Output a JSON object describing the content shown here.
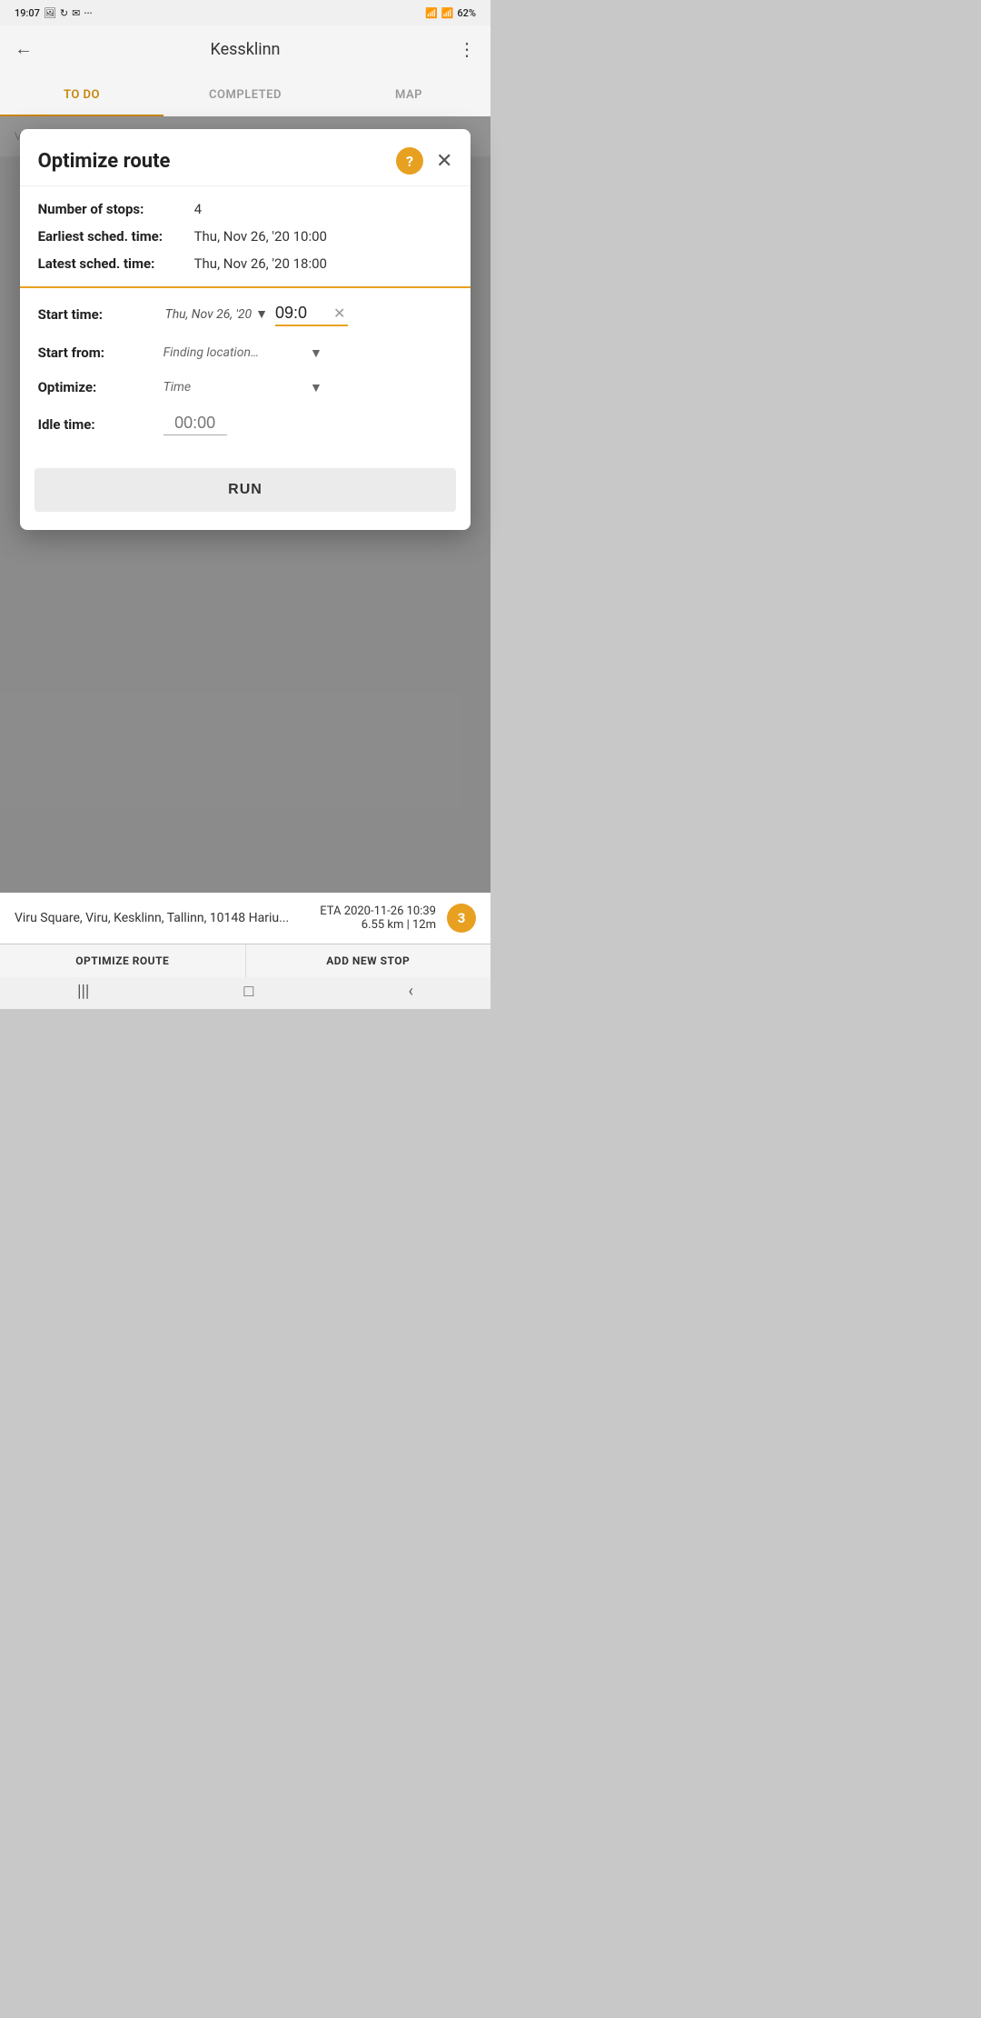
{
  "statusBar": {
    "time": "19:07",
    "icons": [
      "photo",
      "phone-rotate",
      "email",
      "more"
    ],
    "rightIcons": [
      "wifi",
      "signal",
      "signal2",
      "battery"
    ],
    "battery": "62%"
  },
  "appBar": {
    "title": "Kessklinn",
    "backLabel": "←",
    "moreLabel": "⋮"
  },
  "tabs": [
    {
      "id": "todo",
      "label": "TO DO",
      "active": true
    },
    {
      "id": "completed",
      "label": "COMPLETED",
      "active": false
    },
    {
      "id": "map",
      "label": "MAP",
      "active": false
    }
  ],
  "dialog": {
    "title": "Optimize route",
    "helpLabel": "?",
    "closeLabel": "✕",
    "info": {
      "stopsLabel": "Number of stops:",
      "stopsValue": "4",
      "earliestLabel": "Earliest sched. time:",
      "earliestValue": "Thu, Nov 26, '20 10:00",
      "latestLabel": "Latest sched. time:",
      "latestValue": "Thu, Nov 26, '20 18:00"
    },
    "form": {
      "startTimeLabel": "Start time:",
      "startDateValue": "Thu, Nov 26, '20",
      "startTimeValue": "09:0",
      "startFromLabel": "Start from:",
      "startFromValue": "Finding location…",
      "optimizeLabel": "Optimize:",
      "optimizeValue": "Time",
      "idleTimeLabel": "Idle time:",
      "idleTimeValue": "00:00",
      "idleTimePlaceholder": "00:00"
    },
    "runButton": "RUN"
  },
  "bottomCard": {
    "title": "Viru Square, Viru, Kesklinn, Tallinn, 10148 Hariu...",
    "eta": "ETA 2020-11-26 10:39",
    "distance": "6.55 km | 12m",
    "badgeNumber": "3"
  },
  "bottomActions": {
    "optimizeLabel": "OPTIMIZE ROUTE",
    "addLabel": "ADD NEW STOP"
  },
  "navBar": {
    "icons": [
      "|||",
      "□",
      "<"
    ]
  }
}
